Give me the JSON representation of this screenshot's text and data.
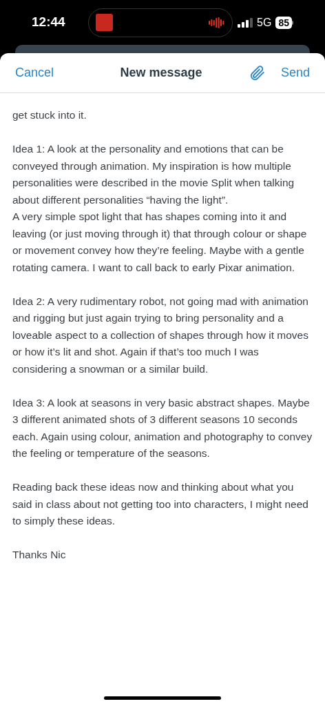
{
  "status_bar": {
    "time": "12:44",
    "network": "5G",
    "battery": "85"
  },
  "header": {
    "cancel": "Cancel",
    "title": "New message",
    "send": "Send"
  },
  "body": [
    [
      "get stuck into it."
    ],
    [
      "Idea 1: A look at the personality and emotions that can be conveyed through animation. My inspiration is how multiple personalities were described in  the movie Split when talking about different personalities “having the light”.",
      "A very simple spot light that has shapes coming into it and leaving (or just moving through it) that through colour or shape or movement convey how they’re feeling. Maybe with a gentle rotating camera. I want to call back to early Pixar animation."
    ],
    [
      "Idea 2:  A very rudimentary robot, not going mad with animation and rigging but just again trying to bring personality and a loveable aspect to a collection of shapes through how it moves or how it’s lit and shot. Again if that’s too much I was considering a snowman or a similar build."
    ],
    [
      "Idea 3: A look at seasons in very basic abstract shapes. Maybe 3 different animated shots of 3 different seasons 10 seconds each. Again using colour, animation and photography to convey the feeling or temperature of the seasons."
    ],
    [
      "Reading back these ideas now and thinking about what you said in class about not getting too into characters, I might need to simply these ideas."
    ],
    [
      "Thanks Nic"
    ]
  ]
}
